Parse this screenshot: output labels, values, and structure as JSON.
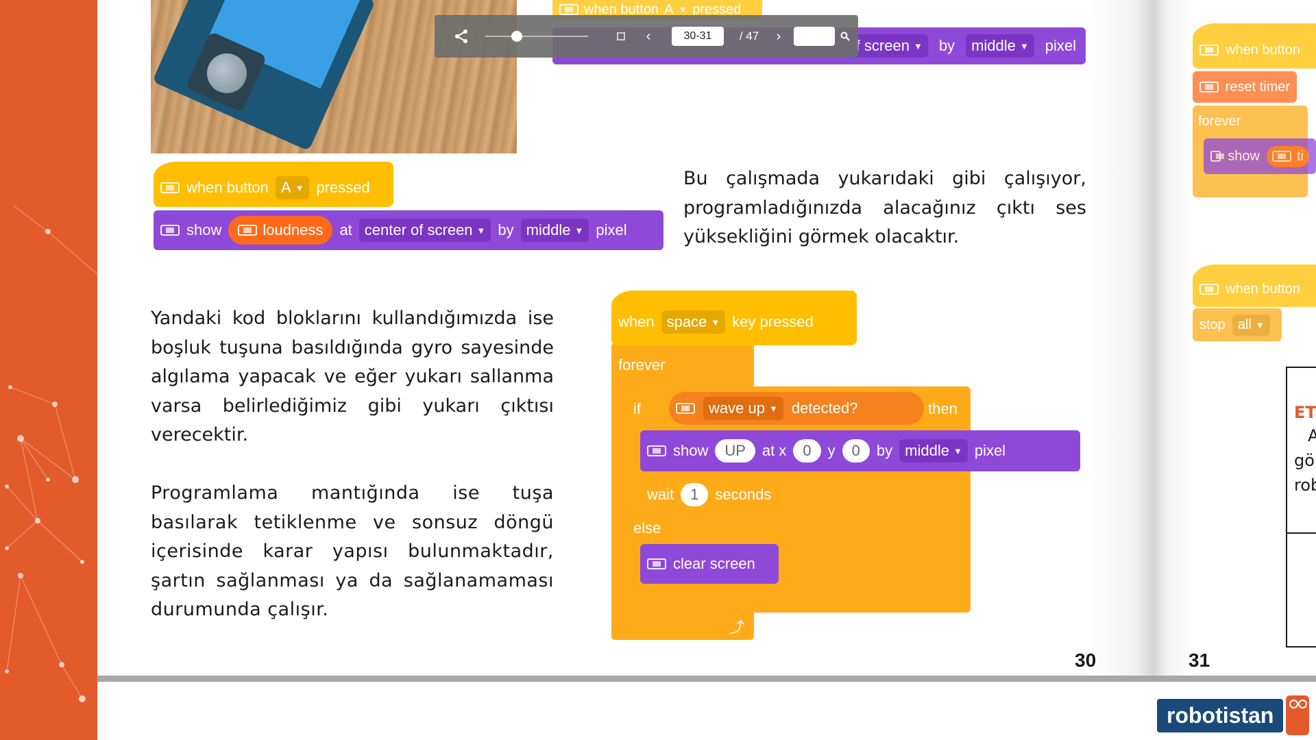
{
  "toolbar": {
    "page_input": "30-31",
    "page_total": "/ 47",
    "search_value": ""
  },
  "left_page": {
    "paragraph_1": "Bu çalışmada yukarıdaki gibi çalışıyor, programladığınızda alacağınız çıktı ses yüksekliğini görmek olacaktır.",
    "paragraph_2": "Yandaki kod bloklarını kullandığımızda ise boşluk tuşuna basıldığında gyro sayesinde algılama yapacak ve eğer yukarı sallanma varsa belirlediğimiz gibi yukarı çıktısı verecektir.",
    "paragraph_3": "Programlama mantığında ise tuşa basılarak tetiklenme ve sonsuz döngü içerisinde karar yapısı bulunmaktadır, şartın sağlanması ya da sağlanamaması durumunda çalışır.",
    "page_number": "30"
  },
  "right_page": {
    "page_number": "31",
    "partial_text": [
      "ET",
      "A",
      "gö",
      "rob"
    ]
  },
  "blocks": {
    "top_partial": {
      "when": "when button",
      "button": "A",
      "pressed": "pressed",
      "screen": "f screen",
      "by": "by",
      "middle": "middle",
      "pixel": "pixel"
    },
    "loudness_script": {
      "when": "when button",
      "button": "A",
      "pressed": "pressed",
      "show": "show",
      "loudness": "loudness",
      "at": "at",
      "position": "center of screen",
      "by": "by",
      "middle": "middle",
      "pixel": "pixel"
    },
    "wave_script": {
      "when": "when",
      "key": "space",
      "key_pressed": "key pressed",
      "forever": "forever",
      "if": "if",
      "wave": "wave up",
      "detected": "detected?",
      "then": "then",
      "show": "show",
      "show_text": "UP",
      "at_x": "at x",
      "x_val": "0",
      "y": "y",
      "y_val": "0",
      "by": "by",
      "middle": "middle",
      "pixel": "pixel",
      "wait": "wait",
      "wait_val": "1",
      "seconds": "seconds",
      "else": "else",
      "clear": "clear screen"
    },
    "right_script_1": {
      "when": "when button",
      "reset": "reset timer",
      "forever": "forever",
      "show": "show",
      "timer_partial": "ti"
    },
    "right_script_2": {
      "when": "when button",
      "stop": "stop",
      "all": "all"
    }
  },
  "logo": {
    "text": "robotistan"
  },
  "colors": {
    "accent_orange": "#e35a2b",
    "event_yellow": "#ffbf00",
    "looks_purple": "#8f49d9",
    "control_orange": "#ffab19"
  }
}
